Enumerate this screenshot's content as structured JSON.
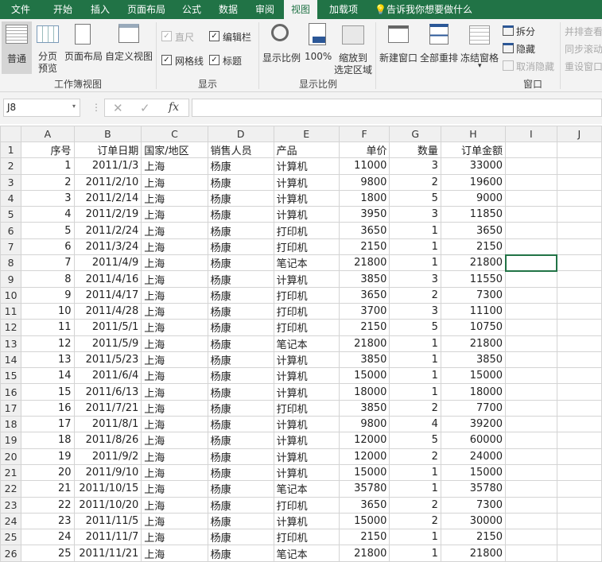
{
  "tabs": [
    "文件",
    "开始",
    "插入",
    "页面布局",
    "公式",
    "数据",
    "审阅",
    "视图",
    "加载项"
  ],
  "active_tab": "视图",
  "tell_me": "告诉我你想要做什么",
  "ribbon": {
    "workbook_views": {
      "label": "工作簿视图",
      "normal": "普通",
      "page_break": "分页",
      "page_break2": "预览",
      "page_layout": "页面布局",
      "custom": "自定义视图"
    },
    "show": {
      "label": "显示",
      "ruler": "直尺",
      "formula_bar": "编辑栏",
      "gridlines": "网格线",
      "headings": "标题"
    },
    "zoom": {
      "label": "显示比例",
      "zoom": "显示比例",
      "zoom100": "100%",
      "zoom_sel": "缩放到",
      "zoom_sel2": "选定区域"
    },
    "window": {
      "label": "窗口",
      "new": "新建窗口",
      "arrange": "全部重排",
      "freeze": "冻结窗格",
      "split": "拆分",
      "hide": "隐藏",
      "unhide": "取消隐藏",
      "side": "并排查看",
      "sync": "同步滚动",
      "reset": "重设窗口位置"
    }
  },
  "name_box": "J8",
  "formula": "",
  "columns": [
    "A",
    "B",
    "C",
    "D",
    "E",
    "F",
    "G",
    "H",
    "I",
    "J"
  ],
  "headers": [
    "序号",
    "订单日期",
    "国家/地区",
    "销售人员",
    "产品",
    "单价",
    "数量",
    "订单金额"
  ],
  "rows": [
    [
      1,
      "2011/1/3",
      "上海",
      "杨康",
      "计算机",
      11000,
      3,
      33000
    ],
    [
      2,
      "2011/2/10",
      "上海",
      "杨康",
      "计算机",
      9800,
      2,
      19600
    ],
    [
      3,
      "2011/2/14",
      "上海",
      "杨康",
      "计算机",
      1800,
      5,
      9000
    ],
    [
      4,
      "2011/2/19",
      "上海",
      "杨康",
      "计算机",
      3950,
      3,
      11850
    ],
    [
      5,
      "2011/2/24",
      "上海",
      "杨康",
      "打印机",
      3650,
      1,
      3650
    ],
    [
      6,
      "2011/3/24",
      "上海",
      "杨康",
      "打印机",
      2150,
      1,
      2150
    ],
    [
      7,
      "2011/4/9",
      "上海",
      "杨康",
      "笔记本",
      21800,
      1,
      21800
    ],
    [
      8,
      "2011/4/16",
      "上海",
      "杨康",
      "计算机",
      3850,
      3,
      11550
    ],
    [
      9,
      "2011/4/17",
      "上海",
      "杨康",
      "打印机",
      3650,
      2,
      7300
    ],
    [
      10,
      "2011/4/28",
      "上海",
      "杨康",
      "打印机",
      3700,
      3,
      11100
    ],
    [
      11,
      "2011/5/1",
      "上海",
      "杨康",
      "打印机",
      2150,
      5,
      10750
    ],
    [
      12,
      "2011/5/9",
      "上海",
      "杨康",
      "笔记本",
      21800,
      1,
      21800
    ],
    [
      13,
      "2011/5/23",
      "上海",
      "杨康",
      "计算机",
      3850,
      1,
      3850
    ],
    [
      14,
      "2011/6/4",
      "上海",
      "杨康",
      "计算机",
      15000,
      1,
      15000
    ],
    [
      15,
      "2011/6/13",
      "上海",
      "杨康",
      "计算机",
      18000,
      1,
      18000
    ],
    [
      16,
      "2011/7/21",
      "上海",
      "杨康",
      "打印机",
      3850,
      2,
      7700
    ],
    [
      17,
      "2011/8/1",
      "上海",
      "杨康",
      "计算机",
      9800,
      4,
      39200
    ],
    [
      18,
      "2011/8/26",
      "上海",
      "杨康",
      "计算机",
      12000,
      5,
      60000
    ],
    [
      19,
      "2011/9/2",
      "上海",
      "杨康",
      "计算机",
      12000,
      2,
      24000
    ],
    [
      20,
      "2011/9/10",
      "上海",
      "杨康",
      "计算机",
      15000,
      1,
      15000
    ],
    [
      21,
      "2011/10/15",
      "上海",
      "杨康",
      "笔记本",
      35780,
      1,
      35780
    ],
    [
      22,
      "2011/10/20",
      "上海",
      "杨康",
      "打印机",
      3650,
      2,
      7300
    ],
    [
      23,
      "2011/11/5",
      "上海",
      "杨康",
      "计算机",
      15000,
      2,
      30000
    ],
    [
      24,
      "2011/11/7",
      "上海",
      "杨康",
      "打印机",
      2150,
      1,
      2150
    ],
    [
      25,
      "2011/11/21",
      "上海",
      "杨康",
      "笔记本",
      21800,
      1,
      21800
    ]
  ],
  "colors": {
    "accent": "#217346",
    "ribbon": "#f3f3f3"
  }
}
